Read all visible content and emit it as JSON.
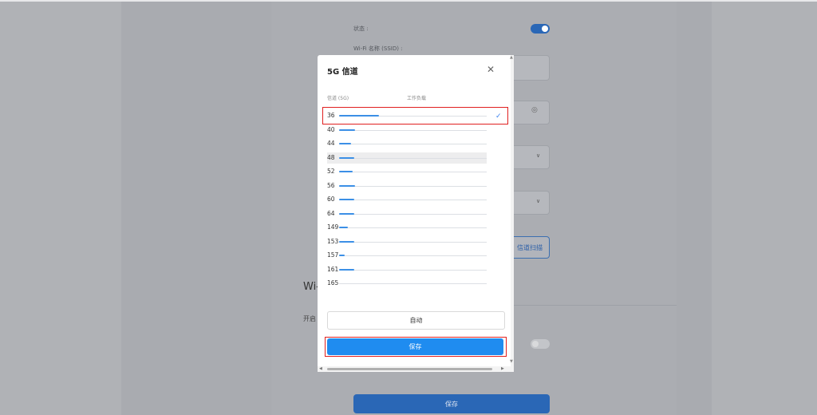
{
  "background": {
    "status_label": "状态 :",
    "ssid_label": "Wi-Fi 名称 (SSID) :",
    "channel_scan_button": "信道扫描",
    "section_title_fragment": "Wi-",
    "enable_label_fragment": "开启",
    "save_button": "保存"
  },
  "modal": {
    "title": "5G 信道",
    "close_icon": "close-icon",
    "col_channel": "信道 (5G)",
    "col_load": "工作负载",
    "channels": [
      {
        "num": "36",
        "load": 0.27
      },
      {
        "num": "40",
        "load": 0.11
      },
      {
        "num": "44",
        "load": 0.08
      },
      {
        "num": "48",
        "load": 0.1
      },
      {
        "num": "52",
        "load": 0.09
      },
      {
        "num": "56",
        "load": 0.11
      },
      {
        "num": "60",
        "load": 0.1
      },
      {
        "num": "64",
        "load": 0.1
      },
      {
        "num": "149",
        "load": 0.06
      },
      {
        "num": "153",
        "load": 0.1
      },
      {
        "num": "157",
        "load": 0.04
      },
      {
        "num": "161",
        "load": 0.1
      },
      {
        "num": "165",
        "load": 0.0
      }
    ],
    "selected_channel": "36",
    "auto_button": "自动",
    "save_button": "保存"
  },
  "colors": {
    "accent": "#1f8cf0",
    "load_bar": "#3b8fe6",
    "highlight": "#e02020"
  }
}
